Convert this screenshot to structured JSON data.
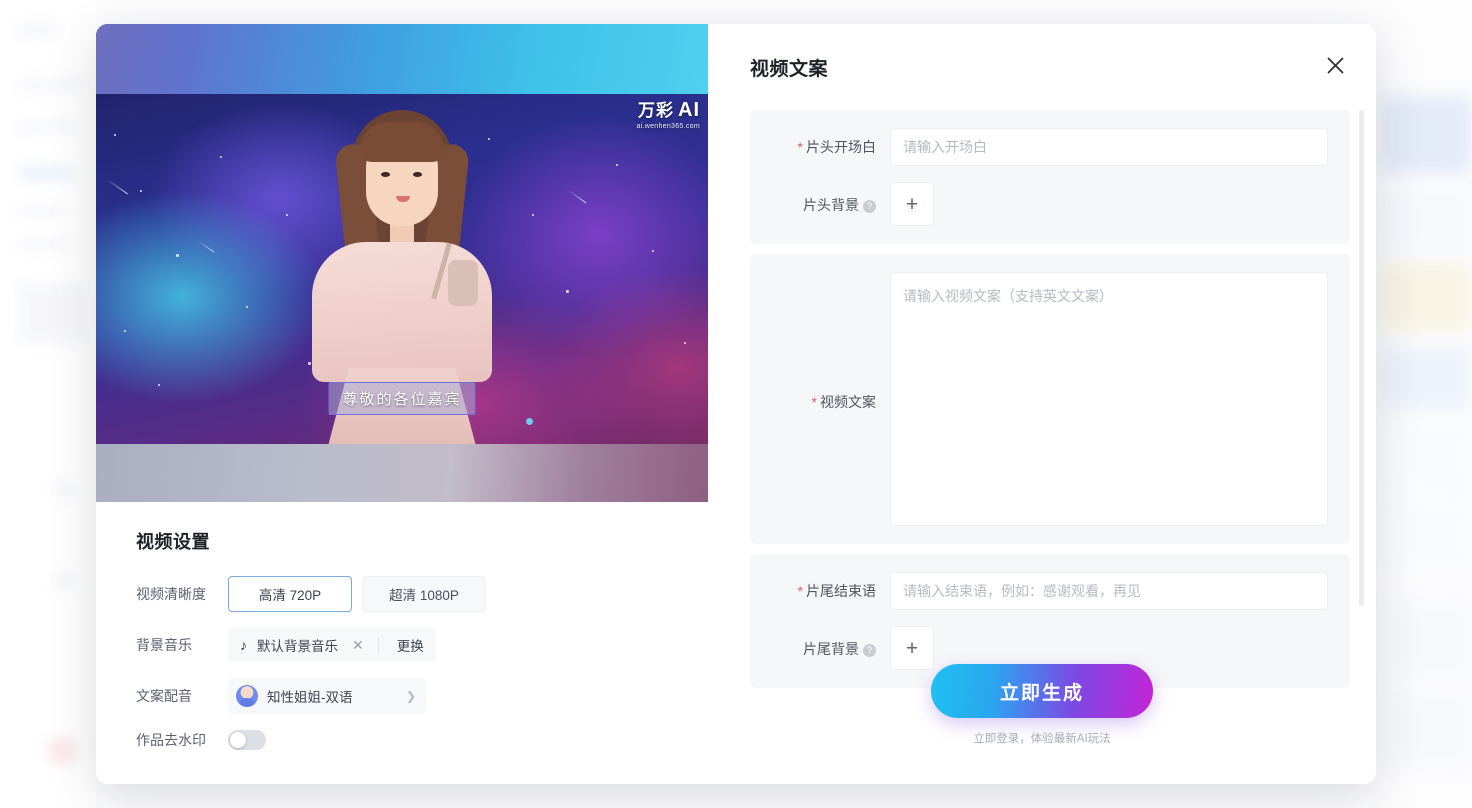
{
  "preview": {
    "subtitle": "尊敬的各位嘉宾",
    "watermark_brand": "万彩",
    "watermark_ai": "AI",
    "watermark_url": "ai.wenhen365.com"
  },
  "settings": {
    "title": "视频设置",
    "quality": {
      "label": "视频清晰度",
      "options": [
        {
          "label": "高清 720P",
          "selected": true
        },
        {
          "label": "超清 1080P",
          "selected": false
        }
      ]
    },
    "music": {
      "label": "背景音乐",
      "note_icon": "music-note-icon",
      "value": "默认背景音乐",
      "clear_icon": "close-icon",
      "change_label": "更换"
    },
    "voice": {
      "label": "文案配音",
      "value": "知性姐姐-双语",
      "arrow_icon": "chevron-right-icon"
    },
    "watermark": {
      "label": "作品去水印",
      "enabled": false
    }
  },
  "panel": {
    "title": "视频文案",
    "close_icon": "close-icon",
    "fields": {
      "opening": {
        "required": true,
        "label": "片头开场白",
        "placeholder": "请输入开场白",
        "value": ""
      },
      "opening_bg": {
        "required": false,
        "label": "片头背景",
        "help_icon": "question-mark-icon",
        "add_icon": "plus-icon"
      },
      "script": {
        "required": true,
        "label": "视频文案",
        "placeholder": "请输入视频文案（支持英文文案）",
        "value": ""
      },
      "ending": {
        "required": true,
        "label": "片尾结束语",
        "placeholder": "请输入结束语，例如：感谢观看，再见",
        "value": ""
      },
      "ending_bg": {
        "required": false,
        "label": "片尾背景",
        "help_icon": "question-mark-icon",
        "add_icon": "plus-icon"
      }
    },
    "cta": {
      "label": "立即生成",
      "note": "立即登录，体验最新AI玩法"
    }
  },
  "colors": {
    "accent_start": "#1fc0f1",
    "accent_end": "#c324d6",
    "required_star": "#e45d5d",
    "active_border": "#7da7e0"
  }
}
